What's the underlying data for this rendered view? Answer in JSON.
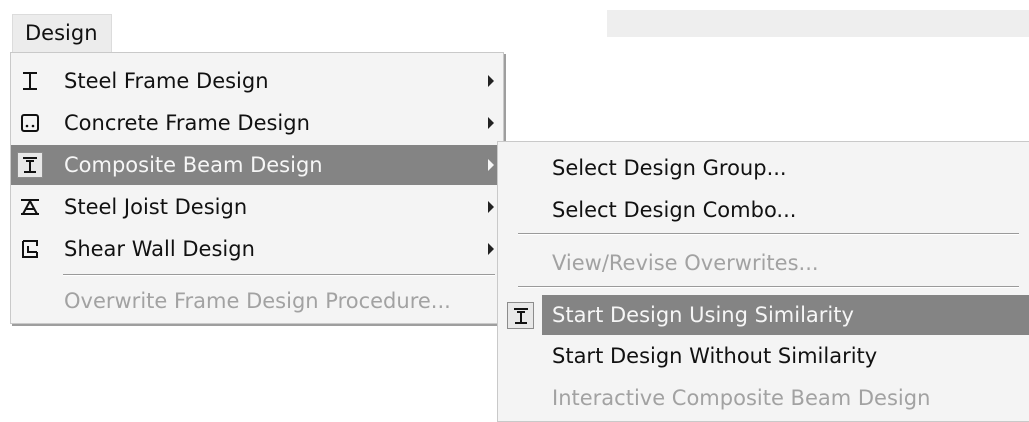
{
  "menubar": {
    "design_label": "Design"
  },
  "design_menu": {
    "items": [
      {
        "label": "Steel Frame Design",
        "icon": "steel-i-beam-icon"
      },
      {
        "label": "Concrete Frame Design",
        "icon": "concrete-section-icon"
      },
      {
        "label": "Composite Beam Design",
        "icon": "composite-beam-icon"
      },
      {
        "label": "Steel Joist Design",
        "icon": "steel-joist-icon"
      },
      {
        "label": "Shear Wall Design",
        "icon": "shear-wall-icon"
      },
      {
        "label": "Overwrite Frame Design Procedure..."
      }
    ]
  },
  "composite_submenu": {
    "items": [
      {
        "label": "Select Design Group..."
      },
      {
        "label": "Select Design Combo..."
      },
      {
        "label": "View/Revise Overwrites..."
      },
      {
        "label": "Start Design Using Similarity",
        "icon": "composite-beam-icon"
      },
      {
        "label": "Start Design Without Similarity"
      },
      {
        "label": "Interactive Composite Beam Design"
      }
    ]
  },
  "colors": {
    "highlight": "#848484",
    "menu_background": "#f4f4f4",
    "disabled_text": "#a2a2a2"
  }
}
